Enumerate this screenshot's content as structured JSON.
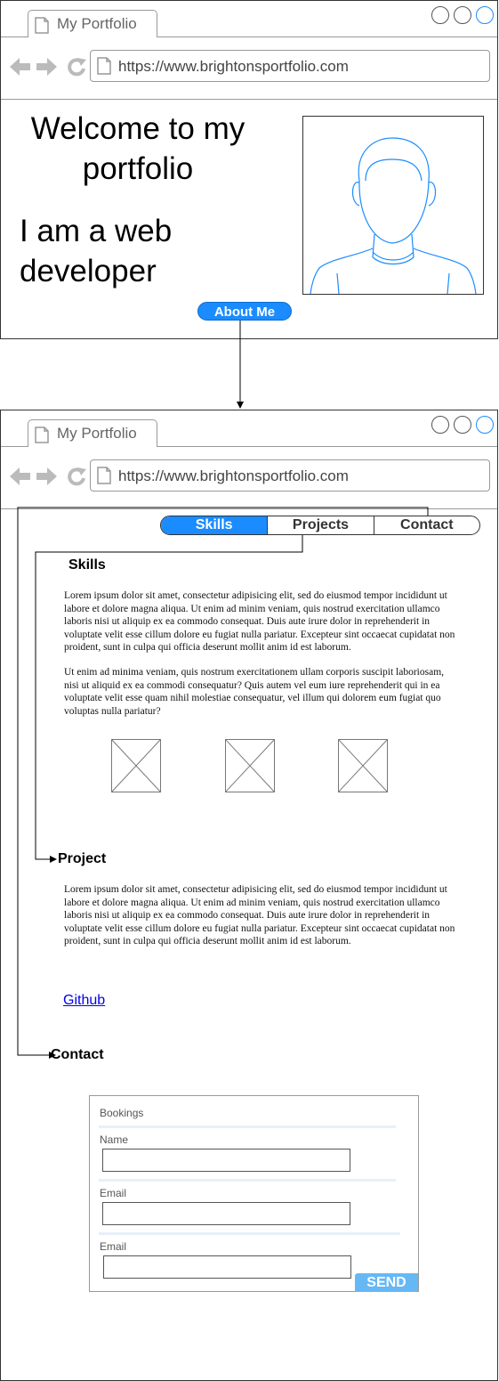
{
  "window1": {
    "tab_title": "My Portfolio",
    "url": "https://www.brightonsportfolio.com",
    "welcome": "Welcome to my portfolio",
    "role": "I am a web developer",
    "about_button": "About Me"
  },
  "window2": {
    "tab_title": "My Portfolio",
    "url": "https://www.brightonsportfolio.com",
    "menu": [
      "Skills",
      "Projects",
      "Contact"
    ],
    "skills_heading": "Skills",
    "skills_text": "Lorem ipsum dolor sit amet, consectetur adipisicing elit, sed do eiusmod tempor incididunt ut labore et dolore magna aliqua. Ut enim ad minim veniam, quis nostrud exercitation ullamco laboris nisi ut aliquip ex ea commodo consequat. Duis aute irure dolor in reprehenderit in voluptate velit esse cillum dolore eu fugiat nulla pariatur. Excepteur sint occaecat cupidatat non proident, sunt in culpa qui officia deserunt mollit anim id est laborum.",
    "skills_text_2": "Ut enim ad minima veniam, quis nostrum exercitationem ullam corporis suscipit laboriosam, nisi ut aliquid ex ea commodi consequatur? Quis autem vel eum iure reprehenderit qui in ea voluptate velit esse quam nihil molestiae consequatur, vel illum qui dolorem eum fugiat quo voluptas nulla pariatur?",
    "project_heading": "Project",
    "project_text": "Lorem ipsum dolor sit amet, consectetur adipisicing elit, sed do eiusmod tempor incididunt ut labore et dolore magna aliqua. Ut enim ad minim veniam, quis nostrud exercitation ullamco laboris nisi ut aliquip ex ea commodo consequat. Duis aute irure dolor in reprehenderit in voluptate velit esse cillum dolore eu fugiat nulla pariatur. Excepteur sint occaecat cupidatat non proident, sunt in culpa qui officia deserunt mollit anim id est laborum.",
    "github_link": "Github",
    "contact_heading": "Contact",
    "form": {
      "title": "Bookings",
      "labels": [
        "Name",
        "Email",
        "Email"
      ],
      "send_button": "SEND"
    }
  },
  "colors": {
    "accent": "#1a8cff",
    "send": "#66b8f5",
    "link": "#0000ee"
  },
  "icons": [
    "page-icon",
    "back-arrow-icon",
    "forward-arrow-icon",
    "reload-icon",
    "person-placeholder-icon",
    "image-placeholder-icon"
  ]
}
